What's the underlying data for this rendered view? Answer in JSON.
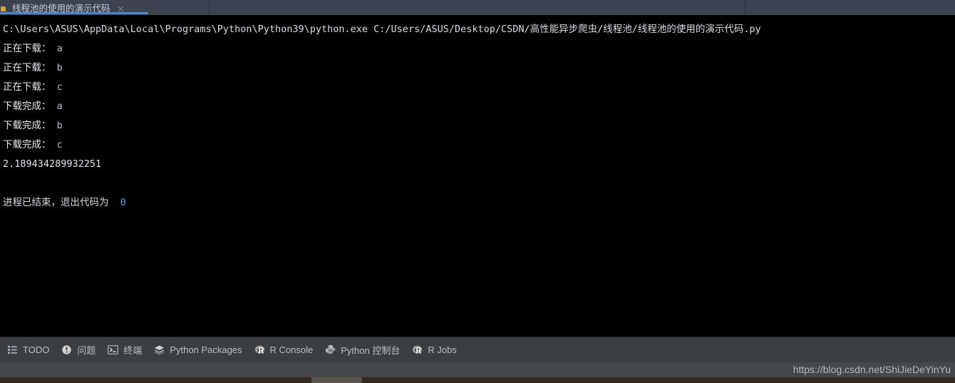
{
  "window": {
    "accent_blue": "#4a88c7",
    "tabbar_bg": "#3c4350",
    "console_bg": "#000000",
    "statusbar_bg": "#3c3f41"
  },
  "tabs": [
    {
      "label": "线程池的使用的演示代码",
      "icon": "run-configuration-icon",
      "close_icon": "close-icon",
      "active": true
    }
  ],
  "console": {
    "lines": [
      {
        "id": "command",
        "segments": [
          {
            "text": "C:\\Users\\ASUS\\AppData\\Local\\Programs\\Python\\Python39\\python.exe C:/Users/ASUS/Desktop/CSDN/高性能异步爬虫/线程池/线程池的使用的演示代码.py",
            "style": "c-cmd"
          }
        ]
      },
      {
        "id": "downloading-a",
        "segments": [
          {
            "text": "正在下载：",
            "style": "c-white"
          },
          {
            "text": " a",
            "style": "c-val"
          }
        ]
      },
      {
        "id": "downloading-b",
        "segments": [
          {
            "text": "正在下载：",
            "style": "c-white"
          },
          {
            "text": " b",
            "style": "c-val"
          }
        ]
      },
      {
        "id": "downloading-c",
        "segments": [
          {
            "text": "正在下载：",
            "style": "c-white"
          },
          {
            "text": " c",
            "style": "c-val"
          }
        ]
      },
      {
        "id": "finished-a",
        "segments": [
          {
            "text": "下载完成：",
            "style": "c-white"
          },
          {
            "text": " a",
            "style": "c-val"
          }
        ]
      },
      {
        "id": "finished-b",
        "segments": [
          {
            "text": "下载完成：",
            "style": "c-white"
          },
          {
            "text": " b",
            "style": "c-val"
          }
        ]
      },
      {
        "id": "finished-c",
        "segments": [
          {
            "text": "下载完成：",
            "style": "c-white"
          },
          {
            "text": " c",
            "style": "c-val"
          }
        ]
      },
      {
        "id": "elapsed-seconds",
        "segments": [
          {
            "text": "2.189434289932251",
            "style": "c-float"
          }
        ]
      },
      {
        "id": "blank-1",
        "segments": [
          {
            "text": " ",
            "style": "c-white"
          }
        ]
      },
      {
        "id": "process-exit",
        "segments": [
          {
            "text": "进程已结束，退出代码为",
            "style": "c-exit"
          },
          {
            "text": "  ",
            "style": "c-exit"
          },
          {
            "text": "0",
            "style": "c-num"
          }
        ]
      }
    ]
  },
  "tool_window_bar": {
    "buttons": [
      {
        "label": "TODO",
        "icon": "todo-list-icon"
      },
      {
        "label": "问题",
        "icon": "problems-warning-icon"
      },
      {
        "label": "终端",
        "icon": "terminal-icon"
      },
      {
        "label": "Python Packages",
        "icon": "packages-layers-icon"
      },
      {
        "label": "R Console",
        "icon": "r-logo-icon"
      },
      {
        "label": "Python 控制台",
        "icon": "python-logo-icon"
      },
      {
        "label": "R Jobs",
        "icon": "r-logo-icon"
      }
    ]
  },
  "watermark": {
    "text": "https://blog.csdn.net/ShiJieDeYinYu"
  },
  "scrollbar": {
    "orientation": "horizontal"
  }
}
